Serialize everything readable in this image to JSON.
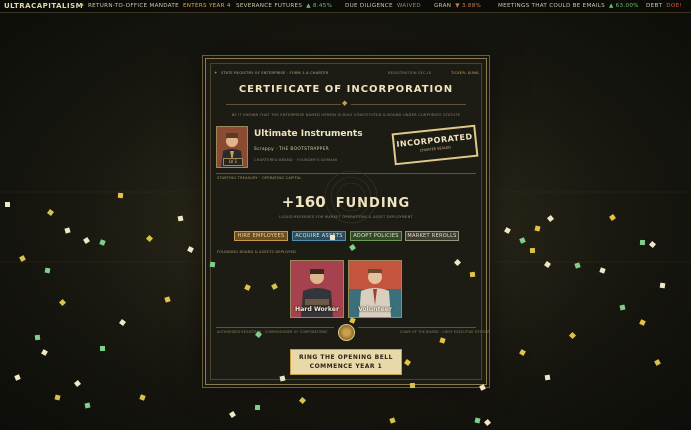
{
  "ticker": {
    "brand": "ULTRACAPITALISM",
    "items": [
      {
        "label": "RETURN-TO-OFFICE MANDATE",
        "value": "ENTERS YEAR 4"
      },
      {
        "label": "SEVERANCE FUTURES",
        "value": "▲ 8.45%"
      },
      {
        "label": "DUE DILIGENCE",
        "value": "WAIVED"
      },
      {
        "label": "GRAN",
        "value": "▼ 3.88%"
      },
      {
        "label": "MEETINGS THAT COULD BE EMAILS",
        "value": "▲ 63.00%"
      },
      {
        "label": "DEBT",
        "value": "DOE!"
      }
    ]
  },
  "certificate": {
    "header_left": "STATE REGISTRY OF ENTERPRISE · FORM 1-A CHARTER",
    "registration": "REGISTRATION SEC-IX",
    "ticker_label": "TICKER: $UNIL",
    "title": "CERTIFICATE OF INCORPORATION",
    "preamble": "BE IT KNOWN THAT THE ENTERPRISE NAMED HEREIN IS DULY CONSTITUTED & BOUND UNDER CORPORATE STATUTE",
    "company_name": "Ultimate Instruments",
    "company_tagline": "Scrappy · THE BOOTSTRAPPER",
    "company_sub": "CHARTERED BRAND · FOUNDER'S DOMAIN",
    "founder_level": "LV 1",
    "stamp": "INCORPORATED",
    "stamp_sub": "CHARTER SEALED",
    "treasury_label": "STARTING TREASURY · OPERATING CAPITAL",
    "funding_amount": "+160",
    "funding_word": "FUNDING",
    "funding_note": "LIQUID RESERVES FOR MARKET OPERATIONS & ASSET DEPLOYMENT",
    "actions": [
      "HIRE EMPLOYEES",
      "ACQUIRE ASSETS",
      "ADOPT POLICIES",
      "MARKET REROLLS"
    ],
    "board_label": "FOUNDING BOARD & ASSETS DEPLOYED",
    "board": [
      {
        "name": "Hard Worker"
      },
      {
        "name": "Volunteer"
      }
    ],
    "sig_left": "AUTHORIZED REGISTRAR · COMMISSIONER OF CORPORATIONS",
    "sig_right": "CHAIR OF THE BOARD · CHIEF EXECUTIVE OFFICER",
    "cta_line1": "RING THE OPENING BELL",
    "cta_line2": "COMMENCE YEAR 1"
  },
  "colors": {
    "accent_gold": "#e0c98a",
    "up": "#6fbf73",
    "down": "#d0794a",
    "hire": "#c89a4a",
    "acquire": "#4f8fb0",
    "adopt": "#6f9a55",
    "reroll": "#9a9480"
  }
}
